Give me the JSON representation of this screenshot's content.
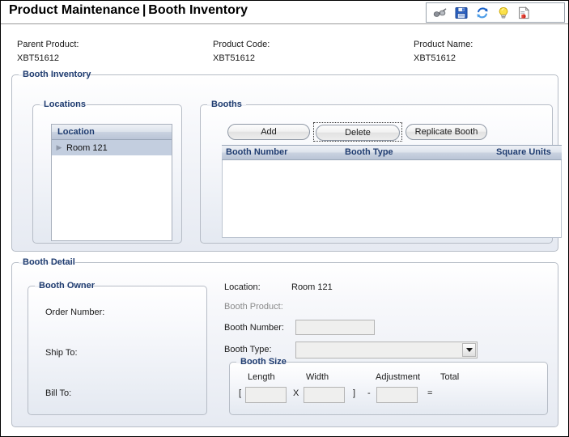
{
  "header": {
    "title_main": "Product Maintenance",
    "title_separator": "|",
    "title_sub": "Booth Inventory",
    "toolbar": [
      {
        "name": "binoculars-icon",
        "label": "Search"
      },
      {
        "name": "save-icon",
        "label": "Save"
      },
      {
        "name": "refresh-icon",
        "label": "Refresh"
      },
      {
        "name": "lightbulb-icon",
        "label": "Hint"
      },
      {
        "name": "report-icon",
        "label": "Report"
      }
    ]
  },
  "product_info": {
    "parent_product_label": "Parent Product:",
    "parent_product_value": "XBT51612",
    "product_code_label": "Product Code:",
    "product_code_value": "XBT51612",
    "product_name_label": "Product Name:",
    "product_name_value": "XBT51612"
  },
  "booth_inventory": {
    "legend": "Booth Inventory",
    "locations": {
      "legend": "Locations",
      "column_header": "Location",
      "rows": [
        {
          "label": "Room 121",
          "expandable": true,
          "selected": true
        }
      ]
    },
    "booths": {
      "legend": "Booths",
      "buttons": [
        {
          "label": "Add",
          "focused": false
        },
        {
          "label": "Delete",
          "focused": true
        },
        {
          "label": "Replicate Booth",
          "focused": false
        }
      ],
      "columns": [
        "Booth Number",
        "Booth Type",
        "Square Units"
      ],
      "rows": []
    }
  },
  "booth_detail": {
    "legend": "Booth Detail",
    "booth_owner": {
      "legend": "Booth Owner",
      "fields": [
        {
          "label": "Order Number:",
          "value": ""
        },
        {
          "label": "Ship To:",
          "value": ""
        },
        {
          "label": "Bill To:",
          "value": ""
        }
      ]
    },
    "location_label": "Location:",
    "location_value": "Room 121",
    "booth_product_label": "Booth Product:",
    "booth_product_value": "",
    "booth_number_label": "Booth Number:",
    "booth_number_value": "",
    "booth_type_label": "Booth Type:",
    "booth_type_value": "",
    "booth_size": {
      "legend": "Booth Size",
      "length_label": "Length",
      "width_label": "Width",
      "adjustment_label": "Adjustment",
      "total_label": "Total",
      "length_value": "",
      "width_value": "",
      "adjustment_value": "",
      "total_value": "",
      "bracket_open": "[",
      "times": "X",
      "bracket_close": "]",
      "minus": "-",
      "equals": "="
    }
  },
  "colors": {
    "legend_text": "#1f3c70",
    "panel_border": "#b6bcc6",
    "grid_header_text": "#1f3c70",
    "tree_selected_bg": "#c3cedf",
    "field_bg": "#efefee"
  }
}
